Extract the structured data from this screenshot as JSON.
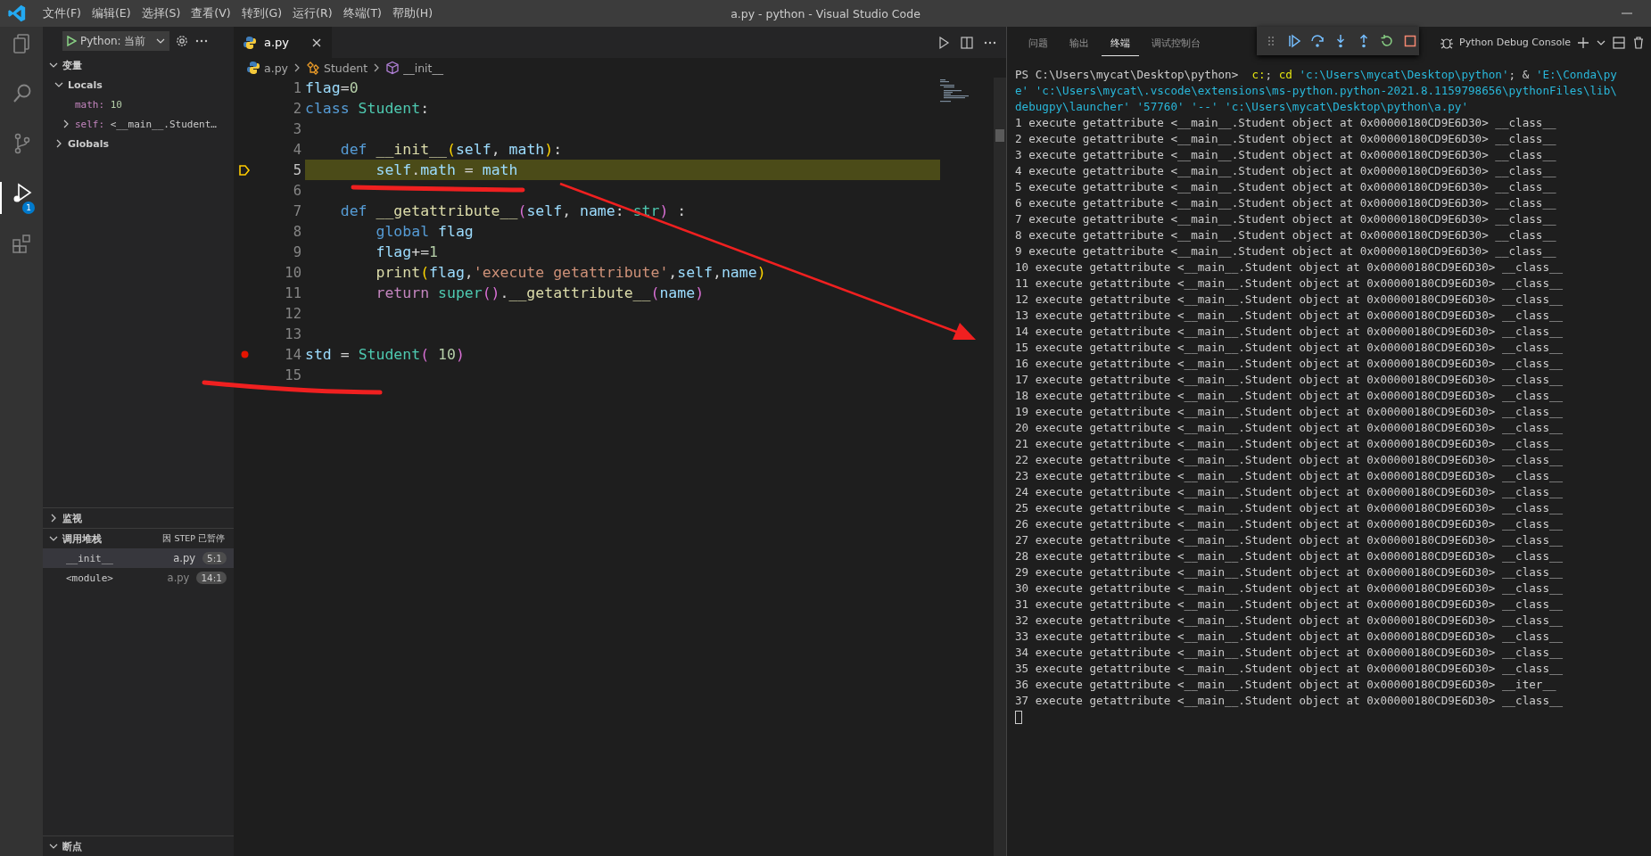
{
  "window": {
    "title": "a.py - python - Visual Studio Code"
  },
  "menu": [
    "文件(F)",
    "编辑(E)",
    "选择(S)",
    "查看(V)",
    "转到(G)",
    "运行(R)",
    "终端(T)",
    "帮助(H)"
  ],
  "activity_bar": [
    {
      "kind": "files",
      "selected": false
    },
    {
      "kind": "search",
      "selected": false
    },
    {
      "kind": "source-control",
      "selected": false
    },
    {
      "kind": "debug",
      "selected": true,
      "badge": "1"
    },
    {
      "kind": "extensions",
      "selected": false
    }
  ],
  "sidebar": {
    "launch_config": "Python: 当前",
    "variables": {
      "title": "变量",
      "expanded": true,
      "scopes": [
        {
          "label": "Locals",
          "expanded": true,
          "children": [
            {
              "name": "math:",
              "value": "10",
              "expandable": false
            },
            {
              "name": "self:",
              "value": "<__main__.Student…",
              "expandable": true
            }
          ]
        },
        {
          "label": "Globals",
          "expanded": false
        }
      ]
    },
    "watch": {
      "title": "监视",
      "expanded": false
    },
    "call_stack": {
      "title": "调用堆栈",
      "expanded": true,
      "status": "因 STEP 已暂停",
      "frames": [
        {
          "name": "__init__",
          "file": "a.py",
          "location": "5:1",
          "selected": true
        },
        {
          "name": "<module>",
          "file": "a.py",
          "location": "14:1",
          "selected": false
        }
      ]
    },
    "breakpoints": {
      "title": "断点",
      "expanded": true
    }
  },
  "editor": {
    "tab": {
      "label": "a.py",
      "selected": true
    },
    "breadcrumbs": [
      {
        "kind": "file",
        "label": "a.py"
      },
      {
        "kind": "class",
        "label": "Student"
      },
      {
        "kind": "method",
        "label": "__init__"
      }
    ],
    "lines": [
      {
        "number": "1",
        "breakpoint": false,
        "current": false,
        "segments": [
          {
            "text": "flag",
            "kind": "var"
          },
          {
            "text": "=",
            "kind": "plain"
          },
          {
            "text": "0",
            "kind": "num"
          }
        ]
      },
      {
        "number": "2",
        "breakpoint": false,
        "current": false,
        "segments": [
          {
            "text": "class",
            "kind": "kw"
          },
          {
            "text": " Student",
            "kind": "cls"
          },
          {
            "text": ":",
            "kind": "plain"
          }
        ]
      },
      {
        "number": "3",
        "breakpoint": false,
        "current": false
      },
      {
        "number": "4",
        "breakpoint": false,
        "current": false,
        "segments": [
          {
            "text": "    def",
            "kind": "kw"
          },
          {
            "text": " __init__",
            "kind": "fn"
          },
          {
            "text": "(",
            "kind": "b1"
          },
          {
            "text": "self",
            "kind": "var"
          },
          {
            "text": ", ",
            "kind": "plain"
          },
          {
            "text": "math",
            "kind": "var"
          },
          {
            "text": ")",
            "kind": "b1"
          },
          {
            "text": ":",
            "kind": "plain"
          }
        ]
      },
      {
        "number": "5",
        "breakpoint": false,
        "current": true,
        "segments": [
          {
            "text": "        self",
            "kind": "var"
          },
          {
            "text": ".",
            "kind": "plain"
          },
          {
            "text": "math",
            "kind": "var"
          },
          {
            "text": " = ",
            "kind": "plain"
          },
          {
            "text": "math",
            "kind": "var"
          }
        ]
      },
      {
        "number": "6",
        "breakpoint": false,
        "current": false
      },
      {
        "number": "7",
        "breakpoint": false,
        "current": false,
        "segments": [
          {
            "text": "    def",
            "kind": "kw"
          },
          {
            "text": " __getattribute__",
            "kind": "fn"
          },
          {
            "text": "(",
            "kind": "b2"
          },
          {
            "text": "self",
            "kind": "var"
          },
          {
            "text": ", ",
            "kind": "plain"
          },
          {
            "text": "name",
            "kind": "var"
          },
          {
            "text": ": ",
            "kind": "plain"
          },
          {
            "text": "str",
            "kind": "cls"
          },
          {
            "text": ")",
            "kind": "b2"
          },
          {
            "text": " :",
            "kind": "plain"
          }
        ]
      },
      {
        "number": "8",
        "breakpoint": false,
        "current": false,
        "segments": [
          {
            "text": "        global",
            "kind": "kw"
          },
          {
            "text": " flag",
            "kind": "var"
          }
        ]
      },
      {
        "number": "9",
        "breakpoint": false,
        "current": false,
        "segments": [
          {
            "text": "        flag",
            "kind": "var"
          },
          {
            "text": "+=",
            "kind": "plain"
          },
          {
            "text": "1",
            "kind": "num"
          }
        ]
      },
      {
        "number": "10",
        "breakpoint": false,
        "current": false,
        "segments": [
          {
            "text": "        print",
            "kind": "fn"
          },
          {
            "text": "(",
            "kind": "b1"
          },
          {
            "text": "flag",
            "kind": "var"
          },
          {
            "text": ",",
            "kind": "plain"
          },
          {
            "text": "'execute getattribute'",
            "kind": "str"
          },
          {
            "text": ",",
            "kind": "plain"
          },
          {
            "text": "self",
            "kind": "var"
          },
          {
            "text": ",",
            "kind": "plain"
          },
          {
            "text": "name",
            "kind": "var"
          },
          {
            "text": ")",
            "kind": "b1"
          }
        ]
      },
      {
        "number": "11",
        "breakpoint": false,
        "current": false,
        "segments": [
          {
            "text": "        return",
            "kind": "ctrl"
          },
          {
            "text": " super",
            "kind": "cls"
          },
          {
            "text": "()",
            "kind": "b2"
          },
          {
            "text": ".",
            "kind": "plain"
          },
          {
            "text": "__getattribute__",
            "kind": "fn"
          },
          {
            "text": "(",
            "kind": "b2"
          },
          {
            "text": "name",
            "kind": "var"
          },
          {
            "text": ")",
            "kind": "b2"
          }
        ]
      },
      {
        "number": "12",
        "breakpoint": false,
        "current": false
      },
      {
        "number": "13",
        "breakpoint": false,
        "current": false
      },
      {
        "number": "14",
        "breakpoint": true,
        "current": false,
        "segments": [
          {
            "text": "std",
            "kind": "var"
          },
          {
            "text": " = ",
            "kind": "plain"
          },
          {
            "text": "Student",
            "kind": "cls"
          },
          {
            "text": "(",
            "kind": "b2"
          },
          {
            "text": " 10",
            "kind": "num"
          },
          {
            "text": ")",
            "kind": "b2"
          }
        ]
      },
      {
        "number": "15",
        "breakpoint": false,
        "current": false
      }
    ]
  },
  "panel": {
    "tabs": [
      {
        "label": "问题",
        "selected": false
      },
      {
        "label": "输出",
        "selected": false
      },
      {
        "label": "终端",
        "selected": true
      },
      {
        "label": "调试控制台",
        "selected": false
      }
    ],
    "terminal_name": "Python Debug Console",
    "terminal": {
      "command_lines": [
        [
          {
            "text": "PS C:\\Users\\mycat\\Desktop\\python>  ",
            "kind": "plain"
          },
          {
            "text": "c:",
            "kind": "command"
          },
          {
            "text": "; ",
            "kind": "plain"
          },
          {
            "text": "cd",
            "kind": "command"
          },
          {
            "text": " 'c:\\Users\\mycat\\Desktop\\python'",
            "kind": "string"
          },
          {
            "text": "; & ",
            "kind": "plain"
          },
          {
            "text": "'E:\\Conda\\py",
            "kind": "string"
          }
        ],
        [
          {
            "text": "e' 'c:\\Users\\mycat\\.vscode\\extensions\\ms-python.python-2021.8.1159798656\\pythonFiles\\lib\\",
            "kind": "string"
          }
        ],
        [
          {
            "text": "debugpy\\launcher' '57760' '--' 'c:\\Users\\mycat\\Desktop\\python\\a.py'",
            "kind": "string"
          }
        ]
      ],
      "output": [
        "1 execute getattribute <__main__.Student object at 0x00000180CD9E6D30> __class__",
        "2 execute getattribute <__main__.Student object at 0x00000180CD9E6D30> __class__",
        "3 execute getattribute <__main__.Student object at 0x00000180CD9E6D30> __class__",
        "4 execute getattribute <__main__.Student object at 0x00000180CD9E6D30> __class__",
        "5 execute getattribute <__main__.Student object at 0x00000180CD9E6D30> __class__",
        "6 execute getattribute <__main__.Student object at 0x00000180CD9E6D30> __class__",
        "7 execute getattribute <__main__.Student object at 0x00000180CD9E6D30> __class__",
        "8 execute getattribute <__main__.Student object at 0x00000180CD9E6D30> __class__",
        "9 execute getattribute <__main__.Student object at 0x00000180CD9E6D30> __class__",
        "10 execute getattribute <__main__.Student object at 0x00000180CD9E6D30> __class__",
        "11 execute getattribute <__main__.Student object at 0x00000180CD9E6D30> __class__",
        "12 execute getattribute <__main__.Student object at 0x00000180CD9E6D30> __class__",
        "13 execute getattribute <__main__.Student object at 0x00000180CD9E6D30> __class__",
        "14 execute getattribute <__main__.Student object at 0x00000180CD9E6D30> __class__",
        "15 execute getattribute <__main__.Student object at 0x00000180CD9E6D30> __class__",
        "16 execute getattribute <__main__.Student object at 0x00000180CD9E6D30> __class__",
        "17 execute getattribute <__main__.Student object at 0x00000180CD9E6D30> __class__",
        "18 execute getattribute <__main__.Student object at 0x00000180CD9E6D30> __class__",
        "19 execute getattribute <__main__.Student object at 0x00000180CD9E6D30> __class__",
        "20 execute getattribute <__main__.Student object at 0x00000180CD9E6D30> __class__",
        "21 execute getattribute <__main__.Student object at 0x00000180CD9E6D30> __class__",
        "22 execute getattribute <__main__.Student object at 0x00000180CD9E6D30> __class__",
        "23 execute getattribute <__main__.Student object at 0x00000180CD9E6D30> __class__",
        "24 execute getattribute <__main__.Student object at 0x00000180CD9E6D30> __class__",
        "25 execute getattribute <__main__.Student object at 0x00000180CD9E6D30> __class__",
        "26 execute getattribute <__main__.Student object at 0x00000180CD9E6D30> __class__",
        "27 execute getattribute <__main__.Student object at 0x00000180CD9E6D30> __class__",
        "28 execute getattribute <__main__.Student object at 0x00000180CD9E6D30> __class__",
        "29 execute getattribute <__main__.Student object at 0x00000180CD9E6D30> __class__",
        "30 execute getattribute <__main__.Student object at 0x00000180CD9E6D30> __class__",
        "31 execute getattribute <__main__.Student object at 0x00000180CD9E6D30> __class__",
        "32 execute getattribute <__main__.Student object at 0x00000180CD9E6D30> __class__",
        "33 execute getattribute <__main__.Student object at 0x00000180CD9E6D30> __class__",
        "34 execute getattribute <__main__.Student object at 0x00000180CD9E6D30> __class__",
        "35 execute getattribute <__main__.Student object at 0x00000180CD9E6D30> __class__",
        "36 execute getattribute <__main__.Student object at 0x00000180CD9E6D30> __iter__",
        "37 execute getattribute <__main__.Student object at 0x00000180CD9E6D30> __class__"
      ]
    }
  }
}
